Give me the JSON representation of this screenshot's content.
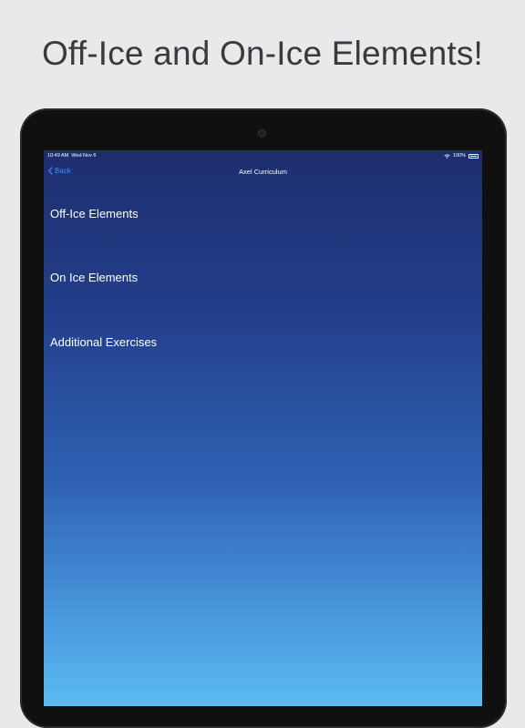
{
  "headline": "Off-Ice and On-Ice Elements!",
  "status_bar": {
    "time": "10:49 AM",
    "date": "Wed Nov 6",
    "battery": "100%"
  },
  "nav": {
    "back_label": "Back",
    "title": "Axel Curriculum"
  },
  "menu_items": [
    {
      "label": "Off-Ice Elements"
    },
    {
      "label": "On Ice Elements"
    },
    {
      "label": "Additional Exercises"
    }
  ],
  "colors": {
    "accent": "#3a8dff",
    "page_background": "#e9e8ea",
    "gradient_top": "#1d2e6e",
    "gradient_bottom": "#5bbaf0"
  }
}
